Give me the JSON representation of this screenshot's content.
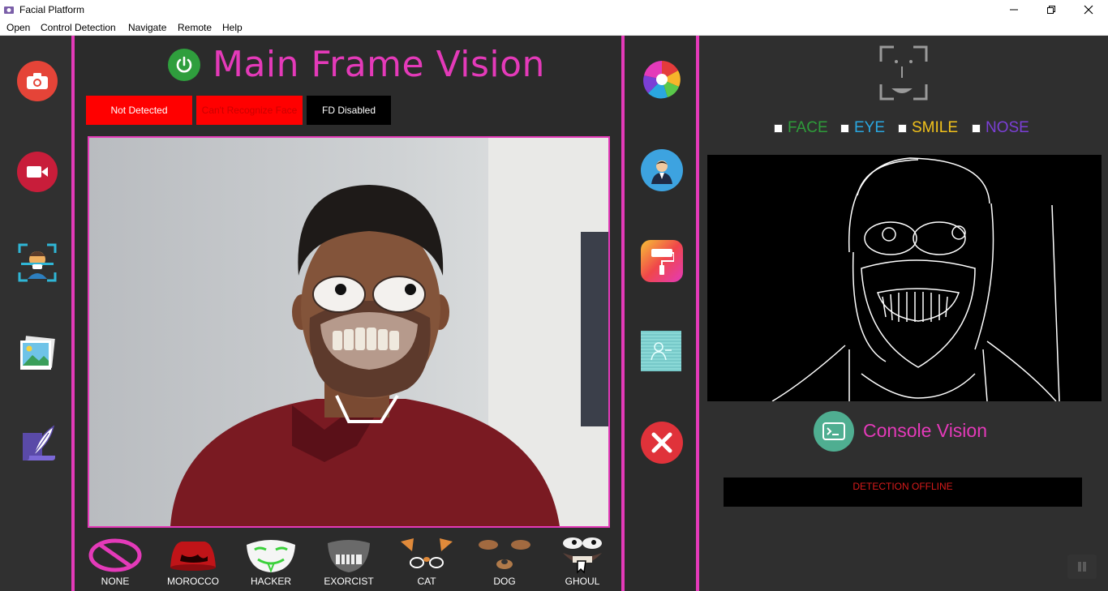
{
  "window": {
    "title": "Facial Platform",
    "controls": [
      "minimize-icon",
      "restore-icon",
      "close-icon"
    ]
  },
  "menu": [
    "Open",
    "Control Detection",
    "Navigate",
    "Remote",
    "Help"
  ],
  "left_sidebar": [
    "camera-icon",
    "video-camera-icon",
    "face-scan-icon",
    "gallery-icon",
    "quill-paper-icon"
  ],
  "main": {
    "title": "Main Frame Vision",
    "status": [
      {
        "text": "Not Detected",
        "bg": "#ff0000",
        "fg": "#ffffff"
      },
      {
        "text": "Can't Recognize Face",
        "bg": "#ff0000",
        "fg": "#cc0000"
      },
      {
        "text": "FD Disabled",
        "bg": "#000000",
        "fg": "#ffffff"
      }
    ],
    "filters": [
      "NONE",
      "MOROCCO",
      "HACKER",
      "EXORCIST",
      "CAT",
      "DOG",
      "GHOUL"
    ]
  },
  "tools": [
    "color-wheel-icon",
    "user-profile-icon",
    "paint-roller-icon",
    "person-glitch-icon",
    "close-circle-icon"
  ],
  "right": {
    "checkboxes": [
      {
        "label": "FACE",
        "color": "#2e9c3a"
      },
      {
        "label": "EYE",
        "color": "#2aa7e0"
      },
      {
        "label": "SMILE",
        "color": "#f2c21b"
      },
      {
        "label": "NOSE",
        "color": "#7b3fd6"
      }
    ],
    "console_title": "Console Vision",
    "detection_status": "DETECTION OFFLINE"
  },
  "colors": {
    "accent": "#e43ab9",
    "panel": "#2b2b2b"
  }
}
